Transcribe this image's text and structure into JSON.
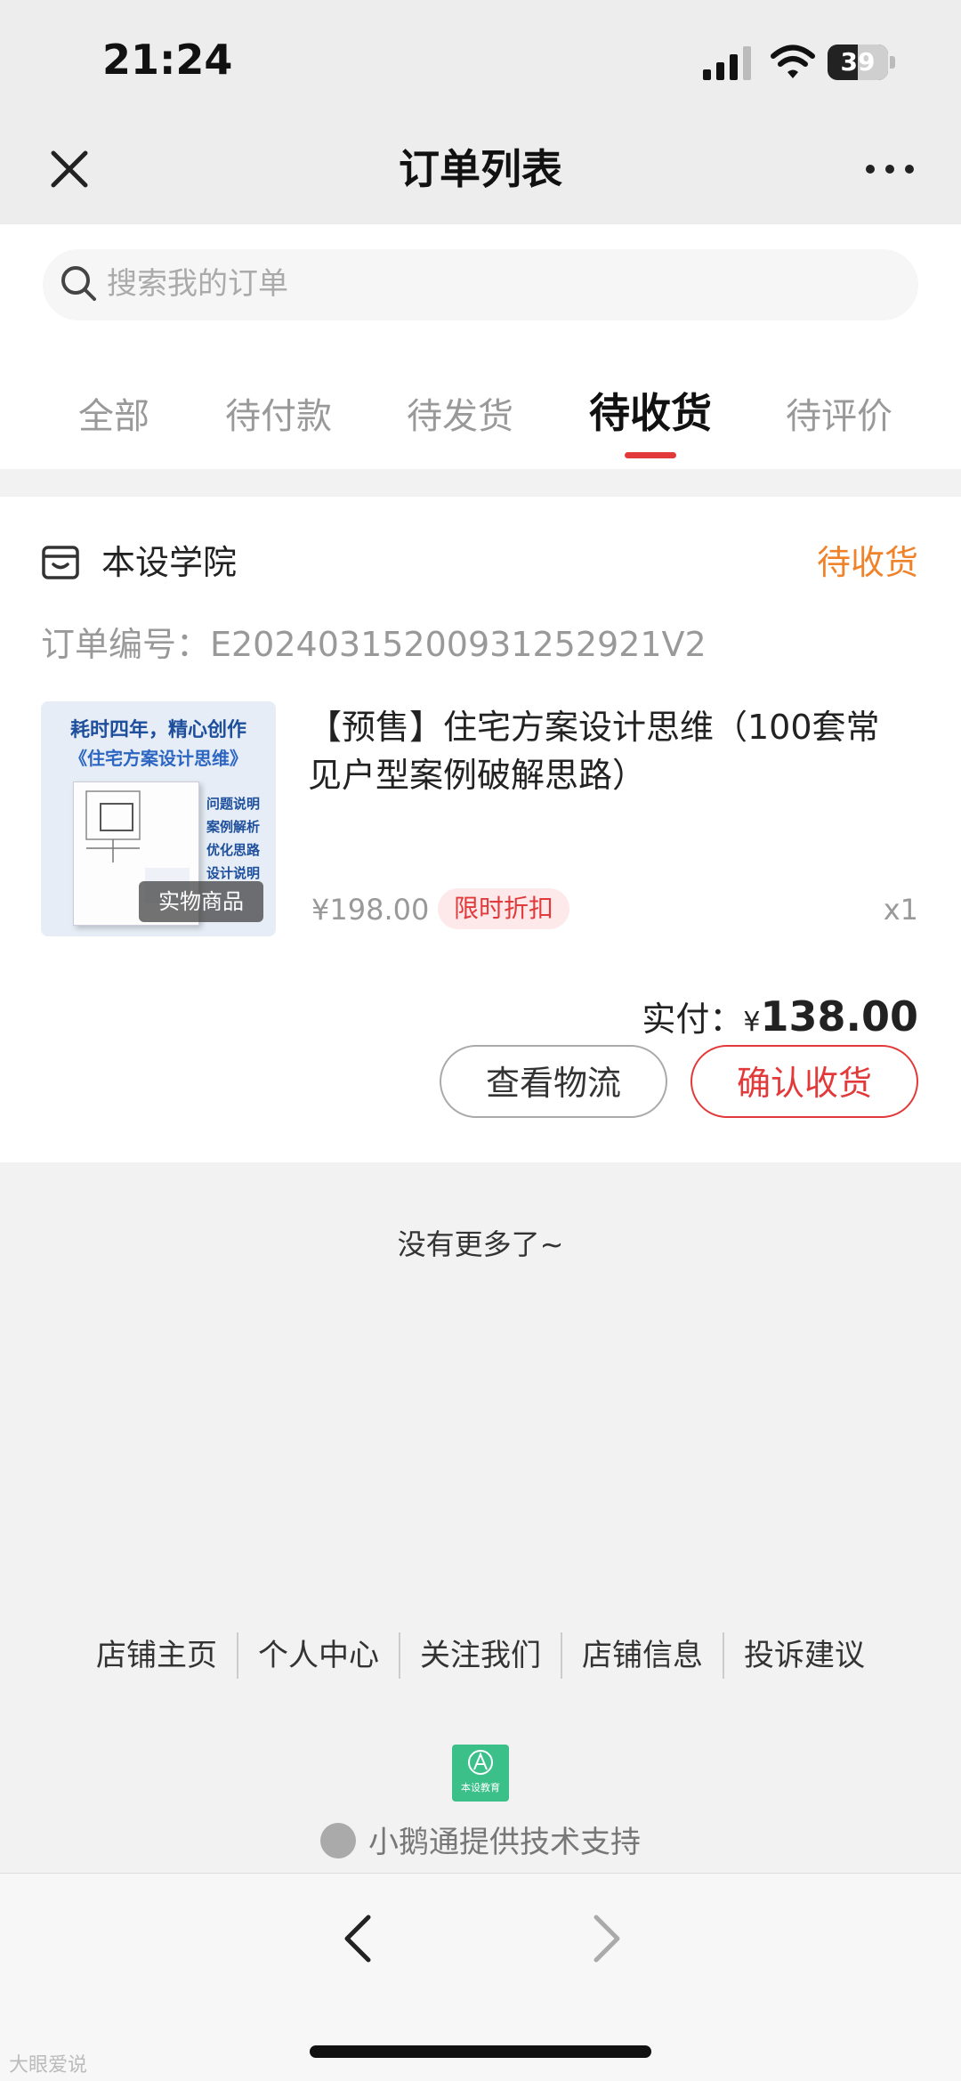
{
  "status_bar": {
    "time": "21:24",
    "battery": "39"
  },
  "nav": {
    "title": "订单列表"
  },
  "search": {
    "placeholder": "搜索我的订单"
  },
  "tabs": [
    {
      "label": "全部"
    },
    {
      "label": "待付款"
    },
    {
      "label": "待发货"
    },
    {
      "label": "待收货",
      "active": true
    },
    {
      "label": "待评价"
    }
  ],
  "order": {
    "shop_name": "本设学院",
    "status": "待收货",
    "order_number": "订单编号：E20240315200931252921V2",
    "product_title": "【预售】住宅方案设计思维（100套常见户型案例破解思路）",
    "thumbnail": {
      "headline": "耗时四年，精心创作",
      "subtitle": "《住宅方案设计思维》",
      "bullets": [
        "问题说明",
        "案例解析",
        "优化思路",
        "设计说明"
      ],
      "badge": "实物商品"
    },
    "original_price": "¥198.00",
    "promo_tag": "限时折扣",
    "quantity": "x1",
    "paid_label": "实付：",
    "paid_currency": "¥",
    "paid_amount": "138.00",
    "buttons": {
      "logistics": "查看物流",
      "confirm": "确认收货"
    }
  },
  "no_more": "没有更多了~",
  "footer": {
    "links": [
      "店铺主页",
      "个人中心",
      "关注我们",
      "店铺信息",
      "投诉建议"
    ],
    "logo_text": "本设教育",
    "powered_by": "小鹅通提供技术支持"
  },
  "watermark": "大眼爱说",
  "colors": {
    "accent_red": "#e23a3a",
    "status_orange": "#f0822a",
    "logo_green": "#3cc08a"
  }
}
